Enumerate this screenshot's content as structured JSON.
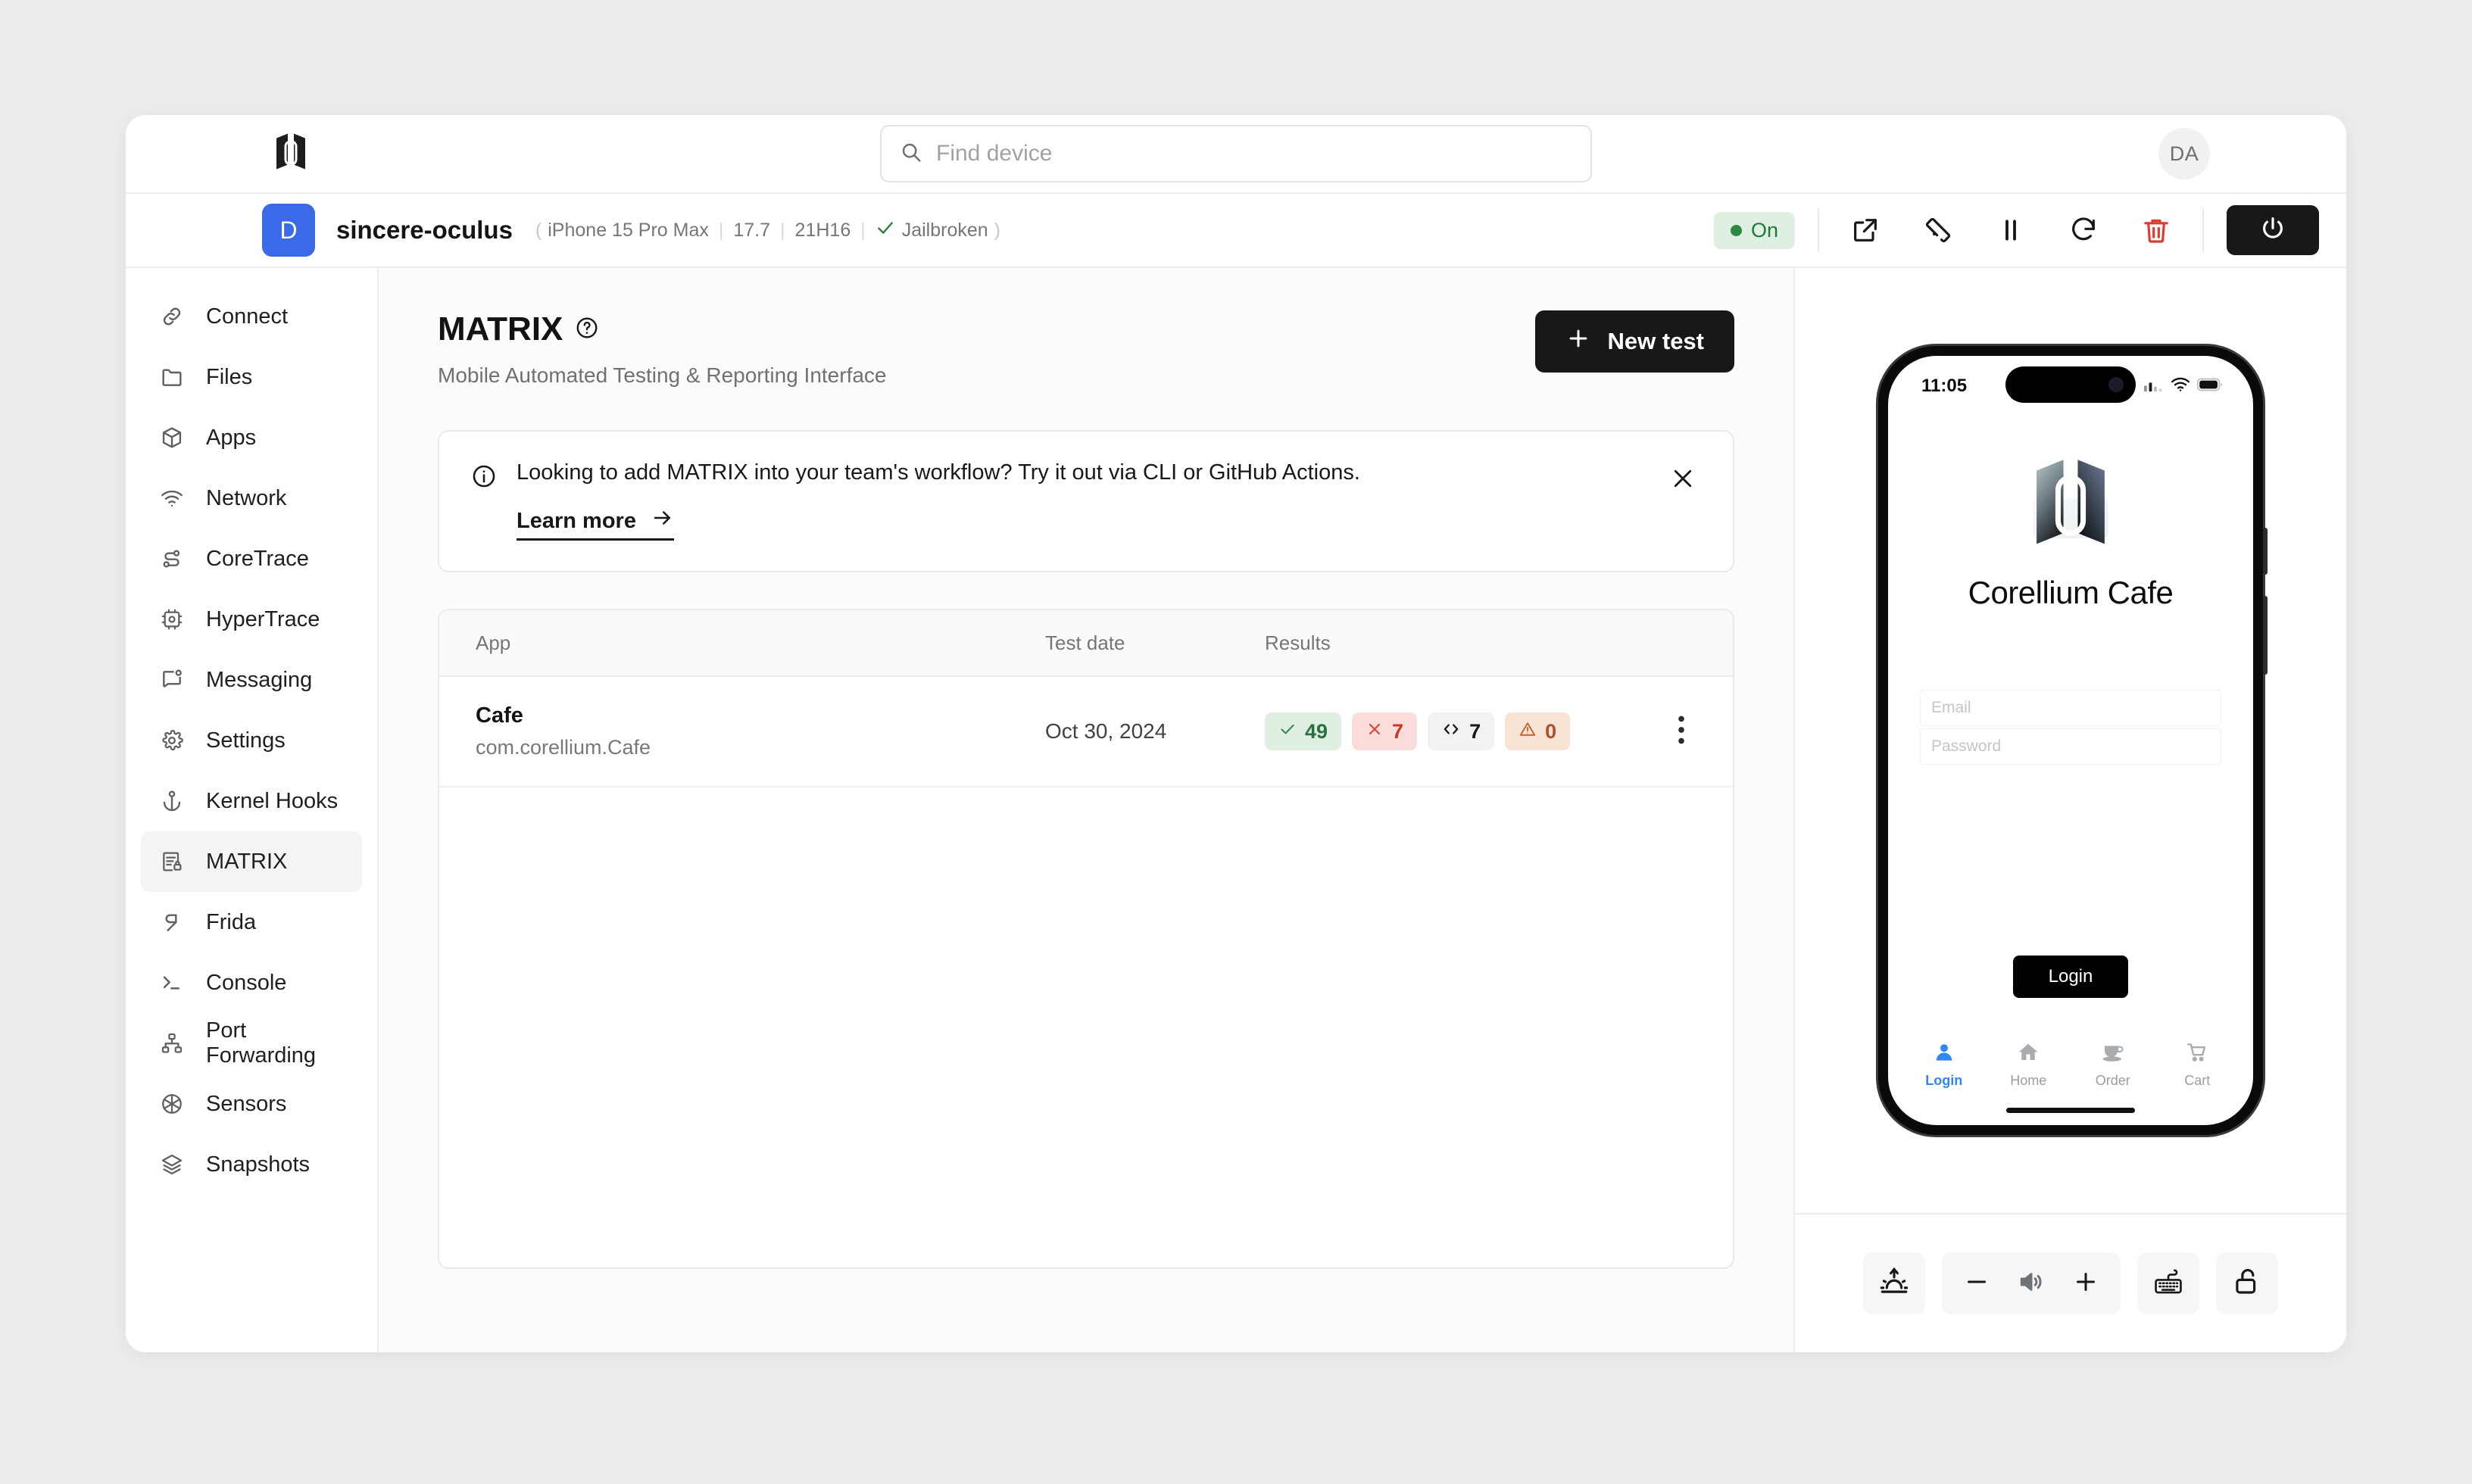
{
  "header": {
    "brand_icon": "corellium-logo",
    "search": {
      "placeholder": "Find device",
      "value": "",
      "icon": "search-icon"
    },
    "avatar_initials": "DA"
  },
  "device_bar": {
    "avatar_letter": "D",
    "name": "sincere-oculus",
    "model": "iPhone 15 Pro Max",
    "os_version": "17.7",
    "build": "21H16",
    "jailbreak_label": "Jailbroken",
    "status_label": "On",
    "status_color": "#2b8a42",
    "tools": [
      {
        "name": "open-external-icon",
        "label": "Open in new window"
      },
      {
        "name": "rotate-device-icon",
        "label": "Rotate"
      },
      {
        "name": "pause-icon",
        "label": "Pause"
      },
      {
        "name": "restart-icon",
        "label": "Restart"
      },
      {
        "name": "delete-icon",
        "label": "Delete",
        "color": "#e03b2f"
      }
    ],
    "power_button": {
      "name": "power-icon",
      "label": "Power"
    }
  },
  "sidebar": {
    "items": [
      {
        "label": "Connect",
        "icon": "link-icon",
        "active": false
      },
      {
        "label": "Files",
        "icon": "folder-icon",
        "active": false
      },
      {
        "label": "Apps",
        "icon": "cube-icon",
        "active": false
      },
      {
        "label": "Network",
        "icon": "wifi-icon",
        "active": false
      },
      {
        "label": "CoreTrace",
        "icon": "coretrace-icon",
        "active": false
      },
      {
        "label": "HyperTrace",
        "icon": "chip-icon",
        "active": false
      },
      {
        "label": "Messaging",
        "icon": "message-icon",
        "active": false
      },
      {
        "label": "Settings",
        "icon": "gear-icon",
        "active": false
      },
      {
        "label": "Kernel Hooks",
        "icon": "anchor-icon",
        "active": false
      },
      {
        "label": "MATRIX",
        "icon": "matrix-report-icon",
        "active": true
      },
      {
        "label": "Frida",
        "icon": "frida-icon",
        "active": false
      },
      {
        "label": "Console",
        "icon": "terminal-icon",
        "active": false
      },
      {
        "label": "Port Forwarding",
        "icon": "network-tree-icon",
        "active": false
      },
      {
        "label": "Sensors",
        "icon": "aperture-icon",
        "active": false
      },
      {
        "label": "Snapshots",
        "icon": "layers-icon",
        "active": false
      }
    ]
  },
  "main": {
    "title": "MATRIX",
    "title_help_icon": "help-circle-icon",
    "subtitle": "Mobile Automated Testing & Reporting Interface",
    "new_test_button": {
      "label": "New test",
      "icon": "plus-icon"
    },
    "banner": {
      "icon": "info-icon",
      "text": "Looking to add MATRIX into your team's workflow? Try it out via CLI or GitHub Actions.",
      "link_label": "Learn more",
      "link_arrow": "arrow-right-icon",
      "close_icon": "close-icon"
    },
    "table": {
      "columns": [
        "App",
        "Test date",
        "Results"
      ],
      "rows": [
        {
          "app_name": "Cafe",
          "app_bundle": "com.corellium.Cafe",
          "test_date": "Oct 30, 2024",
          "results": [
            {
              "type": "passed",
              "icon": "check-icon",
              "count": "49",
              "color": "#2a7040",
              "bg": "#dff0e2"
            },
            {
              "type": "failed",
              "icon": "x-icon",
              "count": "7",
              "color": "#c3392c",
              "bg": "#fadcda"
            },
            {
              "type": "code",
              "icon": "code-icon",
              "count": "7",
              "color": "#16181a",
              "bg": "#f1f2f2"
            },
            {
              "type": "warning",
              "icon": "warning-icon",
              "count": "0",
              "color": "#a8532a",
              "bg": "#f8e3d4"
            }
          ],
          "menu_icon": "kebab-menu-icon"
        }
      ]
    }
  },
  "device_preview": {
    "status_bar": {
      "time": "11:05",
      "cellular_icon": "signal-icon",
      "wifi_icon": "wifi-icon",
      "battery_icon": "battery-icon"
    },
    "app": {
      "logo_icon": "corellium-app-logo",
      "title": "Corellium Cafe",
      "email_placeholder": "Email",
      "password_placeholder": "Password",
      "login_button": "Login",
      "tabs": [
        {
          "label": "Login",
          "icon": "person-icon",
          "active": true
        },
        {
          "label": "Home",
          "icon": "home-icon",
          "active": false
        },
        {
          "label": "Order",
          "icon": "coffee-cup-icon",
          "active": false
        },
        {
          "label": "Cart",
          "icon": "cart-icon",
          "active": false
        }
      ],
      "active_tab_color": "#2e86f7"
    },
    "controls": [
      {
        "name": "brightness-icon",
        "label": "Brightness"
      },
      {
        "name": "volume-down-icon",
        "label": "Volume down"
      },
      {
        "name": "volume-icon",
        "label": "Volume"
      },
      {
        "name": "volume-up-icon",
        "label": "Volume up"
      },
      {
        "name": "keyboard-icon",
        "label": "Keyboard"
      },
      {
        "name": "lock-icon",
        "label": "Lock"
      }
    ]
  }
}
